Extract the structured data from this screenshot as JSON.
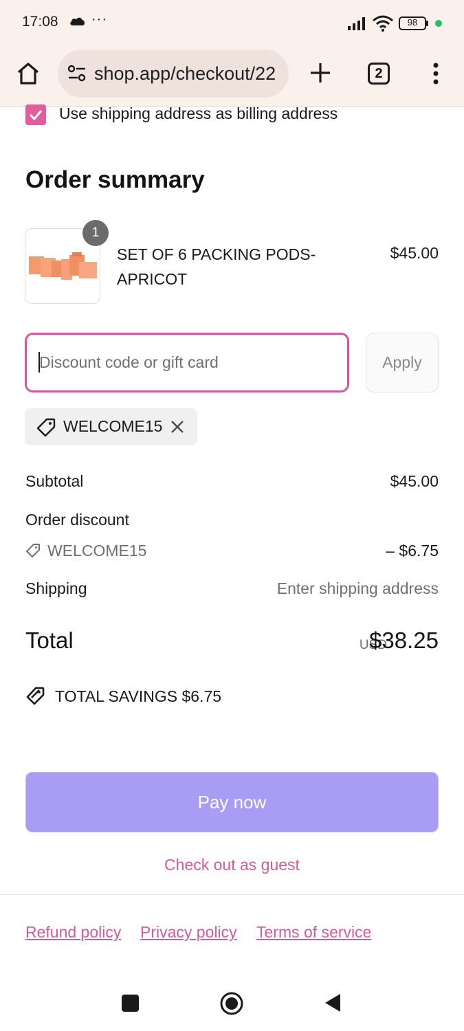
{
  "status_bar": {
    "time": "17:08",
    "dots": "···",
    "battery": "98",
    "dot_color": "#22c35e"
  },
  "browser": {
    "url": "shop.app/checkout/22",
    "tab_count": "2"
  },
  "billing": {
    "checkbox_checked": true,
    "label": "Use shipping address as billing address"
  },
  "order_summary": {
    "title": "Order summary",
    "item": {
      "quantity": "1",
      "name": "SET OF 6 PACKING PODS-APRICOT",
      "price": "$45.00"
    },
    "discount_input": {
      "placeholder": "Discount code or gift card",
      "value": ""
    },
    "apply_label": "Apply",
    "applied_code": "WELCOME15",
    "subtotal": {
      "label": "Subtotal",
      "value": "$45.00"
    },
    "order_discount": {
      "label": "Order discount",
      "code": "WELCOME15",
      "value": "– $6.75"
    },
    "shipping": {
      "label": "Shipping",
      "value": "Enter shipping address"
    },
    "total": {
      "label": "Total",
      "currency": "USD",
      "value": "$38.25"
    },
    "savings": {
      "label": "TOTAL SAVINGS  $6.75"
    }
  },
  "actions": {
    "pay_now": "Pay now",
    "guest": "Check out as guest"
  },
  "footer": {
    "links": [
      "Refund policy",
      "Privacy policy",
      "Terms of service"
    ]
  },
  "colors": {
    "accent_pink": "#d35a9c",
    "pay_button": "#a99cf5",
    "chrome_background": "#fbf1ec"
  }
}
